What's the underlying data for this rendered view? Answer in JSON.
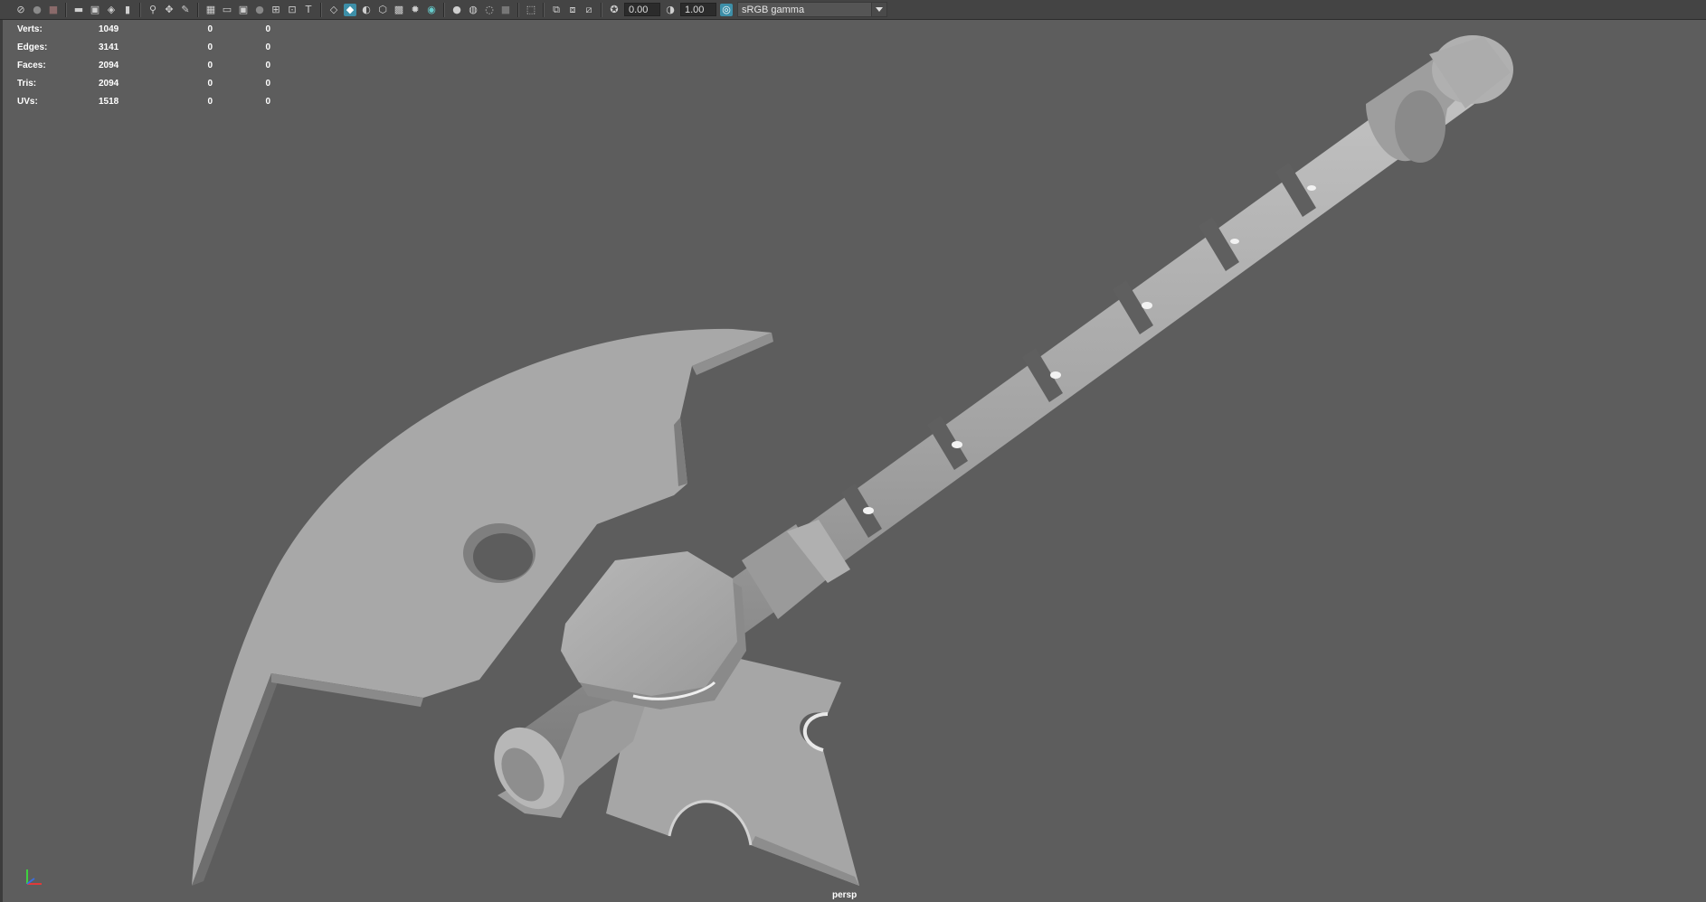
{
  "toolbar": {
    "icons": [
      "select-camera-icon",
      "lock-camera-icon",
      "camera-attr-icon",
      "bookmark-icon",
      "image-plane-icon",
      "2d-pan-icon",
      "grease-pencil-icon",
      "grid-icon",
      "film-gate-icon",
      "resolution-gate-icon",
      "gate-mask-icon",
      "field-chart-icon",
      "safe-action-icon",
      "safe-title-icon",
      "wireframe-icon",
      "smooth-shade-icon",
      "default-lighting-icon",
      "textured-icon",
      "use-lights-icon",
      "shadows-icon",
      "screen-ambient-occlusion-icon",
      "motion-blur-icon",
      "anti-aliasing-icon",
      "depth-of-field-icon",
      "isolate-select-icon",
      "xray-icon",
      "xray-joints-icon",
      "backface-icon",
      "exposure-icon",
      "gamma-icon",
      "color-management-icon"
    ],
    "exposure_value": "0.00",
    "gamma_value": "1.00",
    "view_transform": "sRGB gamma"
  },
  "hud": {
    "rows": [
      {
        "label": "Verts:",
        "v1": "1049",
        "v2": "0",
        "v3": "0"
      },
      {
        "label": "Edges:",
        "v1": "3141",
        "v2": "0",
        "v3": "0"
      },
      {
        "label": "Faces:",
        "v1": "2094",
        "v2": "0",
        "v3": "0"
      },
      {
        "label": "Tris:",
        "v1": "2094",
        "v2": "0",
        "v3": "0"
      },
      {
        "label": "UVs:",
        "v1": "1518",
        "v2": "0",
        "v3": "0"
      }
    ]
  },
  "viewport": {
    "camera_label": "persp",
    "background_color": "#5d5d5d",
    "model_color": "#a9a9a9",
    "model": "axe"
  }
}
